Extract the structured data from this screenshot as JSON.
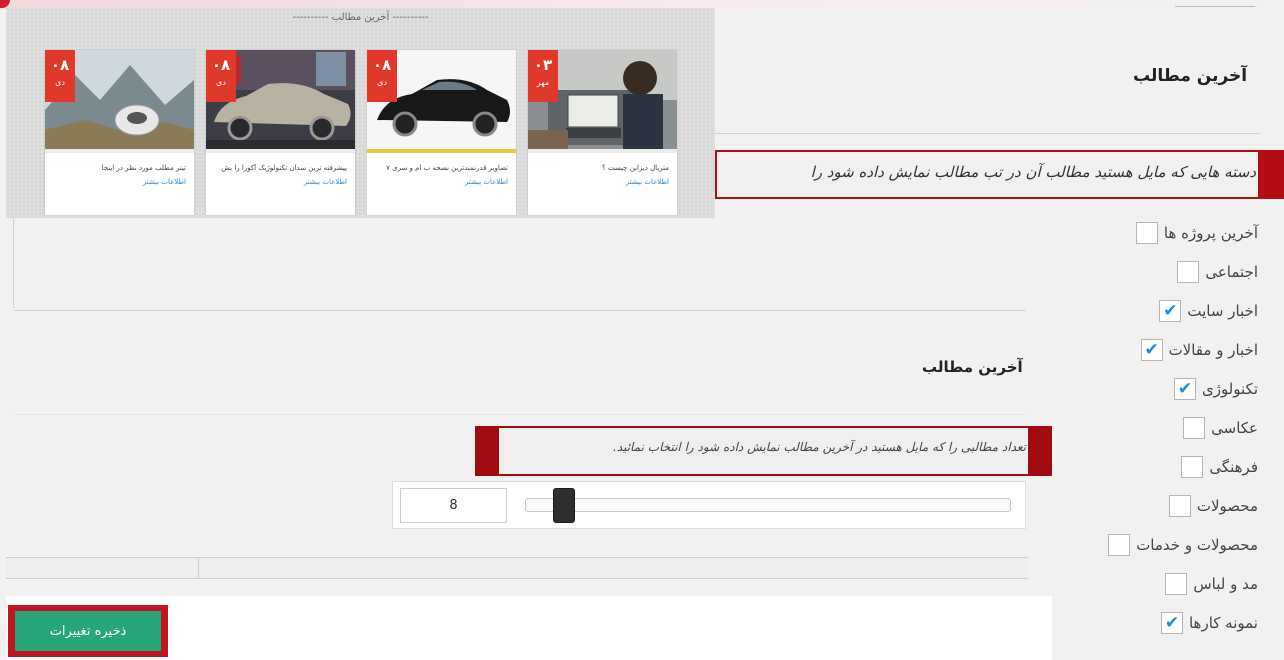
{
  "preview": {
    "title": "---------- آخرین مطالب ----------",
    "cards": [
      {
        "day": "۰۳",
        "month": "مهر",
        "title": "متریال دیزاین چیست ؟",
        "more": "اطلاعات بیشتر",
        "image": "man-laptop-photo",
        "stripe": "#ececec"
      },
      {
        "day": "۰۸",
        "month": "دی",
        "title": "تصاویر قدرتمندترین نسخه ب ام و سری ۷",
        "more": "اطلاعات بیشتر",
        "image": "black-car-photo",
        "stripe": "#e7c83a"
      },
      {
        "day": "۰۸",
        "month": "دی",
        "title": "پیشرفته ترین سدان تکنولوژیک آکورا را بش",
        "more": "اطلاعات بیشتر",
        "image": "silver-car-photo",
        "stripe": "#ececec"
      },
      {
        "day": "۰۸",
        "month": "دی",
        "title": "تیتر مطلب مورد نظر در اینجا",
        "more": "اطلاعات بیشتر",
        "image": "mountain-robot-photo",
        "stripe": "#ececec"
      }
    ]
  },
  "settings": {
    "section_title": "آخرین مطالب",
    "categories_desc": "دسته هایی که مایل هستید مطالب آن در تب مطالب نمایش داده شود را",
    "categories": [
      {
        "label": "آخرین پروژه ها",
        "checked": false
      },
      {
        "label": "اجتماعی",
        "checked": false
      },
      {
        "label": "اخبار سایت",
        "checked": true
      },
      {
        "label": "اخبار و مقالات",
        "checked": true
      },
      {
        "label": "تکنولوژی",
        "checked": true
      },
      {
        "label": "عکاسی",
        "checked": false
      },
      {
        "label": "فرهنگی",
        "checked": false
      },
      {
        "label": "محصولات",
        "checked": false
      },
      {
        "label": "محصولات و خدمات",
        "checked": false
      },
      {
        "label": "مد و لباس",
        "checked": false
      },
      {
        "label": "نمونه کارها",
        "checked": true
      }
    ],
    "count_section_title": "آخرین مطالب",
    "count_desc": "تعداد مطالبی را که مایل هستید در آخرین مطالب نمایش داده شود را انتخاب نمائید.",
    "count_value": "8",
    "slider_fraction": 0.08
  },
  "actions": {
    "save_label": "ذخیره تغییرات"
  },
  "colors": {
    "accent_red": "#b40c15",
    "save_green": "#29a57a",
    "check_blue": "#1e88e5",
    "badge_red": "#e0392b"
  }
}
